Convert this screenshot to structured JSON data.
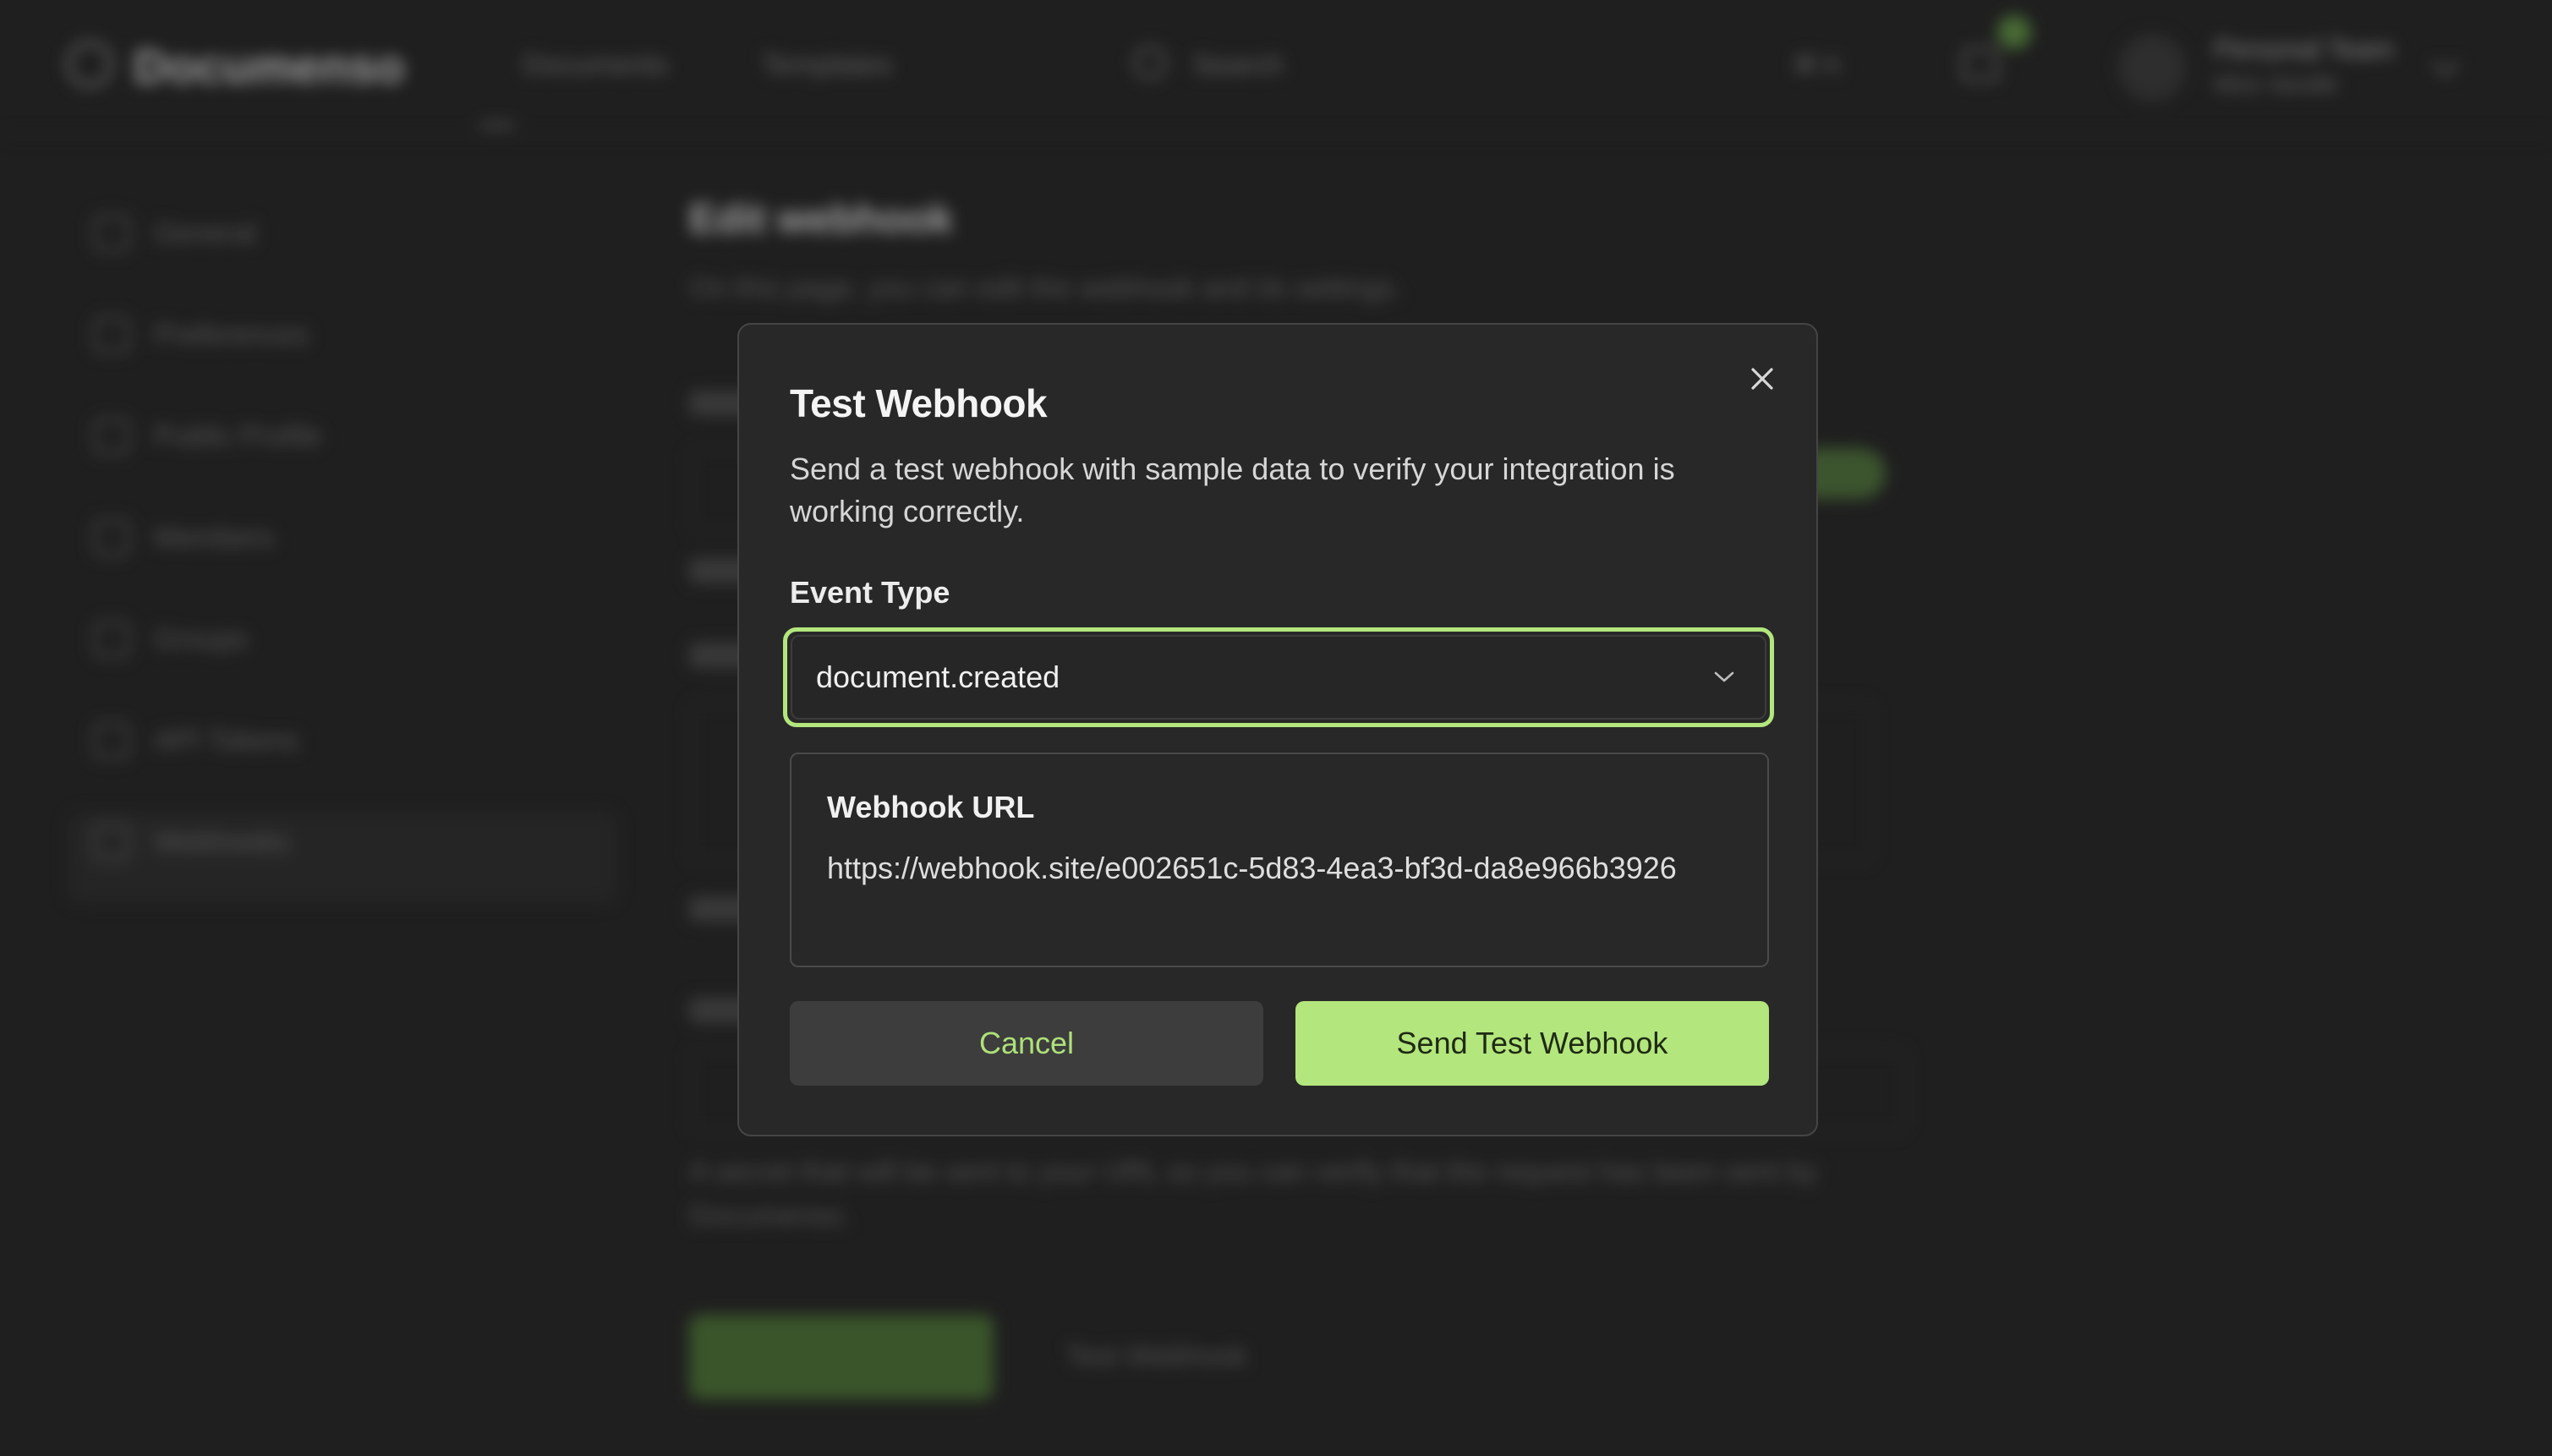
{
  "background": {
    "logo": "Documenso",
    "nav": [
      "Documents",
      "Templates"
    ],
    "search_label": "Search",
    "header_misc": "⌘ K",
    "user_name": "Personal Team",
    "user_sub": "Mira Vandle",
    "sidebar": [
      "General",
      "Preferences",
      "Public Profile",
      "Members",
      "Groups",
      "API Tokens",
      "Webhooks"
    ],
    "page_title": "Edit webhook",
    "page_subtitle": "On this page, you can edit the webhook and its settings.",
    "note": "A secret that will be sent to your URL so you can verify that the request has been sent by Documenso.",
    "test_button": "Test Webhook"
  },
  "dialog": {
    "title": "Test Webhook",
    "description": "Send a test webhook with sample data to verify your integration is working correctly.",
    "event_type_label": "Event Type",
    "event_type_value": "document.created",
    "webhook_url_label": "Webhook URL",
    "webhook_url_value": "https://webhook.site/e002651c-5d83-4ea3-bf3d-da8e966b3926",
    "cancel_label": "Cancel",
    "send_label": "Send Test Webhook"
  },
  "colors": {
    "accent": "#b3e67d",
    "dialog_bg": "#282828",
    "page_bg": "#282828"
  }
}
